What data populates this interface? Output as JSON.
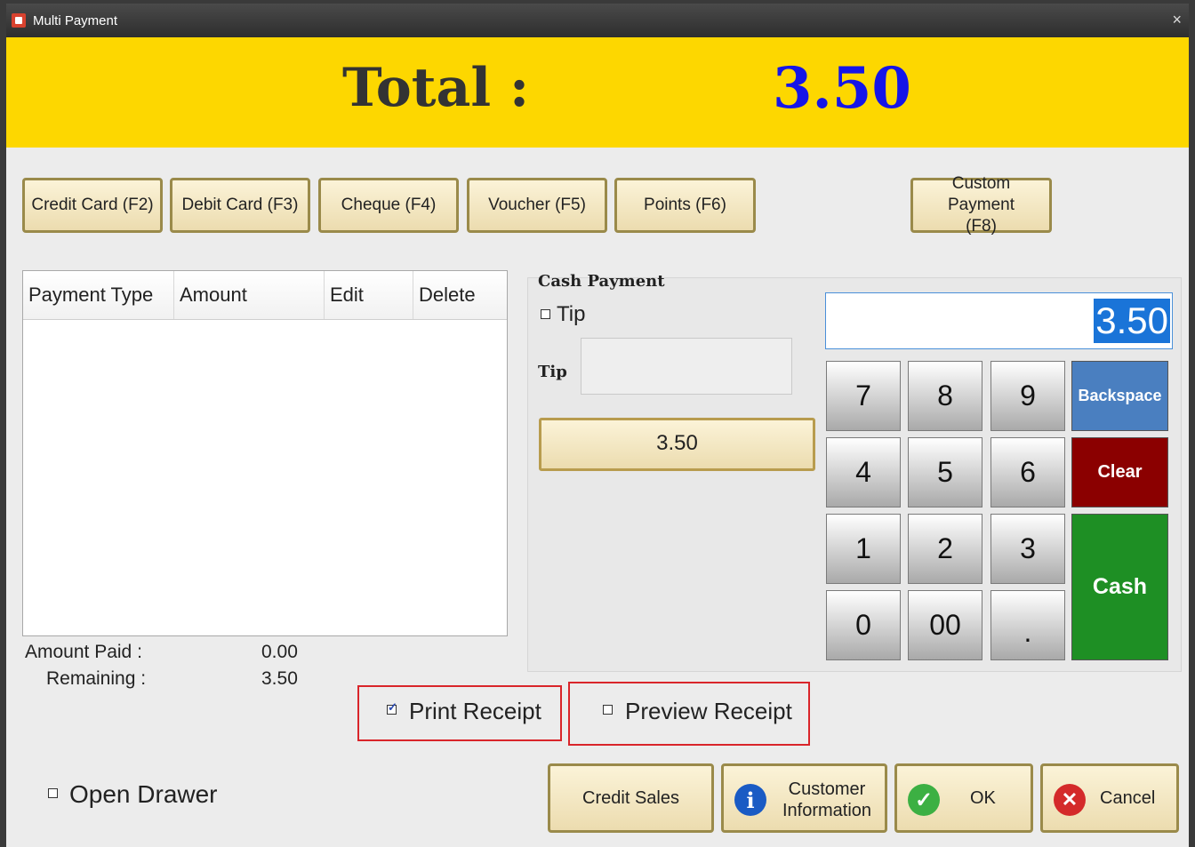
{
  "window": {
    "title": "Multi Payment",
    "close_glyph": "×"
  },
  "total": {
    "label": "Total :",
    "value": "3.50"
  },
  "payment_buttons": [
    {
      "label": "Credit Card (F2)"
    },
    {
      "label": "Debit Card (F3)"
    },
    {
      "label": "Cheque (F4)"
    },
    {
      "label": "Voucher (F5)"
    },
    {
      "label": "Points (F6)"
    },
    {
      "label": "Custom Payment (F8)"
    }
  ],
  "grid": {
    "columns": [
      "Payment Type",
      "Amount",
      "Edit",
      "Delete"
    ],
    "rows": []
  },
  "summary": {
    "amount_paid_label": "Amount Paid :",
    "amount_paid_value": "0.00",
    "remaining_label": "Remaining :",
    "remaining_value": "3.50"
  },
  "cash_payment": {
    "title": "Cash Payment",
    "tip_checkbox_label": "Tip",
    "tip_checked": false,
    "tip_field_label": "Tip",
    "tip_value": "",
    "amount_button": "3.50"
  },
  "keypad": {
    "display_value": "3.50",
    "keys": [
      "7",
      "8",
      "9",
      "4",
      "5",
      "6",
      "1",
      "2",
      "3",
      "0",
      "00",
      "."
    ],
    "backspace": "Backspace",
    "clear": "Clear",
    "cash": "Cash"
  },
  "receipt": {
    "print_label": "Print Receipt",
    "print_checked": true,
    "preview_label": "Preview Receipt",
    "preview_checked": false
  },
  "open_drawer": {
    "label": "Open Drawer",
    "checked": false
  },
  "bottom_buttons": {
    "credit_sales": "Credit Sales",
    "customer_info_line1": "Customer",
    "customer_info_line2": "Information",
    "ok": "OK",
    "cancel": "Cancel"
  },
  "colors": {
    "total_band": "#fdd700",
    "total_value": "#1515e8",
    "backspace": "#4a7fc0",
    "clear": "#8b0000",
    "cash": "#1e8f24",
    "highlight_border": "#d9252a"
  },
  "icons": {
    "app": "app-icon",
    "info": "info-icon",
    "ok": "checkmark-icon",
    "cancel": "cancel-x-icon"
  }
}
